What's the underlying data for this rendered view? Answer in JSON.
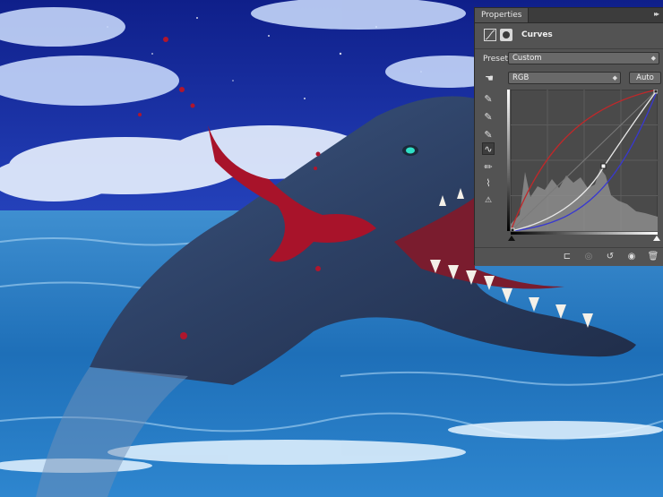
{
  "panel": {
    "tab_label": "Properties",
    "collapse_icon": "double-chevron-right-icon",
    "adjustment_title": "Curves",
    "preset_label": "Preset:",
    "preset_value": "Custom",
    "channel_value": "RGB",
    "auto_label": "Auto",
    "tools": [
      "hand-target-icon",
      "eyedropper-black-icon",
      "eyedropper-gray-icon",
      "eyedropper-white-icon",
      "curve-point-icon",
      "pencil-icon",
      "smooth-icon",
      "clipping-warning-icon"
    ],
    "bottom_icons": [
      "clip-to-layer-icon",
      "view-previous-icon",
      "reset-icon",
      "visibility-eye-icon",
      "trash-icon"
    ]
  },
  "colors": {
    "panel_bg": "#535353",
    "graph_bg": "#4a4a4a",
    "red_curve": "#c0282a",
    "blue_curve": "#3838d0",
    "rgb_curve": "#e8e8e8"
  }
}
